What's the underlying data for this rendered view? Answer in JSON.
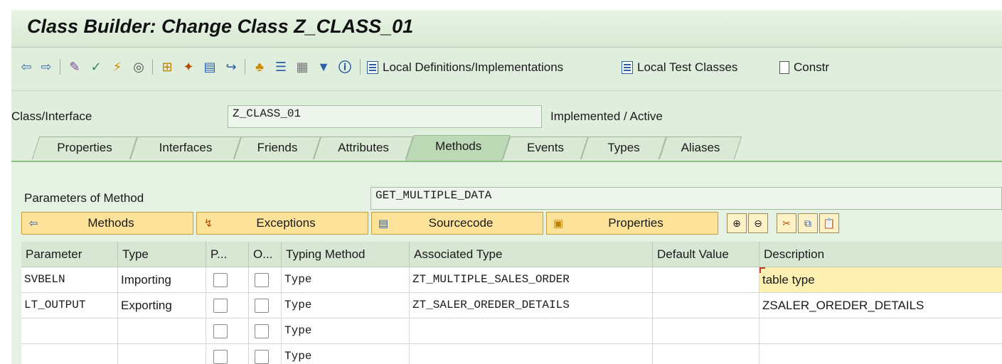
{
  "window": {
    "title": "Class Builder: Change Class Z_CLASS_01"
  },
  "toolbar": {
    "local_defs_label": "Local Definitions/Implementations",
    "local_test_label": "Local Test Classes",
    "constr_label": "Constr"
  },
  "header": {
    "class_label": "Class/Interface",
    "class_value": "Z_CLASS_01",
    "status": "Implemented / Active"
  },
  "tabs": [
    "Properties",
    "Interfaces",
    "Friends",
    "Attributes",
    "Methods",
    "Events",
    "Types",
    "Aliases"
  ],
  "active_tab": "Methods",
  "method": {
    "params_label": "Parameters of Method",
    "method_name": "GET_MULTIPLE_DATA"
  },
  "nav_buttons": [
    "Methods",
    "Exceptions",
    "Sourcecode",
    "Properties"
  ],
  "table": {
    "columns": [
      "Parameter",
      "Type",
      "P...",
      "O...",
      "Typing Method",
      "Associated Type",
      "Default Value",
      "Description"
    ],
    "rows": [
      {
        "parameter": "SVBELN",
        "type": "Importing",
        "p": false,
        "o": false,
        "typing": "Type",
        "assoc": "ZT_MULTIPLE_SALES_ORDER",
        "default": "",
        "desc": "table type"
      },
      {
        "parameter": "LT_OUTPUT",
        "type": "Exporting",
        "p": false,
        "o": false,
        "typing": "Type",
        "assoc": "ZT_SALER_OREDER_DETAILS",
        "default": "",
        "desc": "ZSALER_OREDER_DETAILS"
      },
      {
        "parameter": "",
        "type": "",
        "p": false,
        "o": false,
        "typing": "Type",
        "assoc": "",
        "default": "",
        "desc": ""
      },
      {
        "parameter": "",
        "type": "",
        "p": false,
        "o": false,
        "typing": "Type",
        "assoc": "",
        "default": "",
        "desc": ""
      }
    ]
  },
  "colors": {
    "accent": "#bcd9b5",
    "button": "#fde39a",
    "highlight": "#fdf0b3"
  }
}
